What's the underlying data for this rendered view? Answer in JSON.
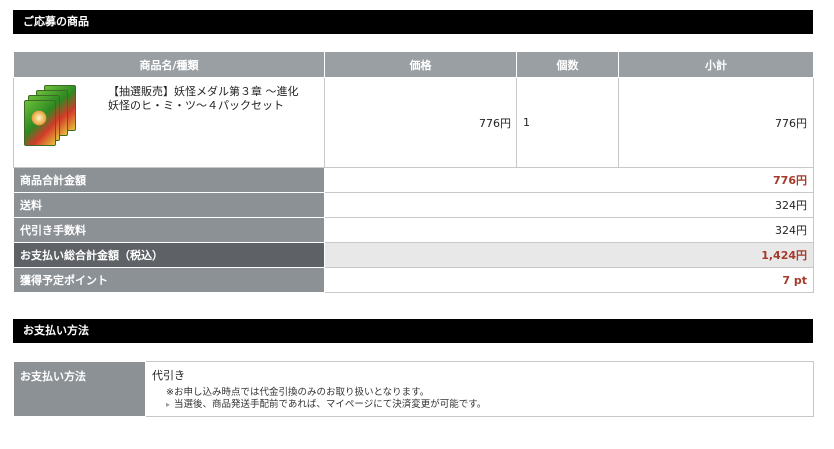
{
  "sections": {
    "items_title": "ご応募の商品",
    "payment_title": "お支払い方法"
  },
  "order_table": {
    "headers": [
      "商品名/種類",
      "価格",
      "個数",
      "小計"
    ],
    "product": {
      "name_line1": "【抽選販売】妖怪メダル第３章 〜進化",
      "name_line2": "妖怪のヒ・ミ・ツ〜４パックセット",
      "price": "776円",
      "quantity": "1",
      "subtotal": "776円",
      "thumbnail_icon": "yokai-medal-pack-image"
    }
  },
  "summary": {
    "product_total_label": "商品合計金額",
    "product_total_value": "776円",
    "shipping_label": "送料",
    "shipping_value": "324円",
    "cod_fee_label": "代引き手数料",
    "cod_fee_value": "324円",
    "grand_total_label": "お支払い総合計金額（税込）",
    "grand_total_value": "1,424円",
    "points_label": "獲得予定ポイント",
    "points_value": "7 pt"
  },
  "payment": {
    "label": "お支払い方法",
    "method": "代引き",
    "note_line1": "※お申し込み時点では代金引換のみのお取り扱いとなります。",
    "note_line2": "当選後、商品発送手配前であれば、マイページにて決済変更が可能です。"
  },
  "colors": {
    "header_bar": "#000000",
    "table_header": "#9a9fa4",
    "label_bg": "#8c9196",
    "accent_red": "#a53a2a"
  }
}
